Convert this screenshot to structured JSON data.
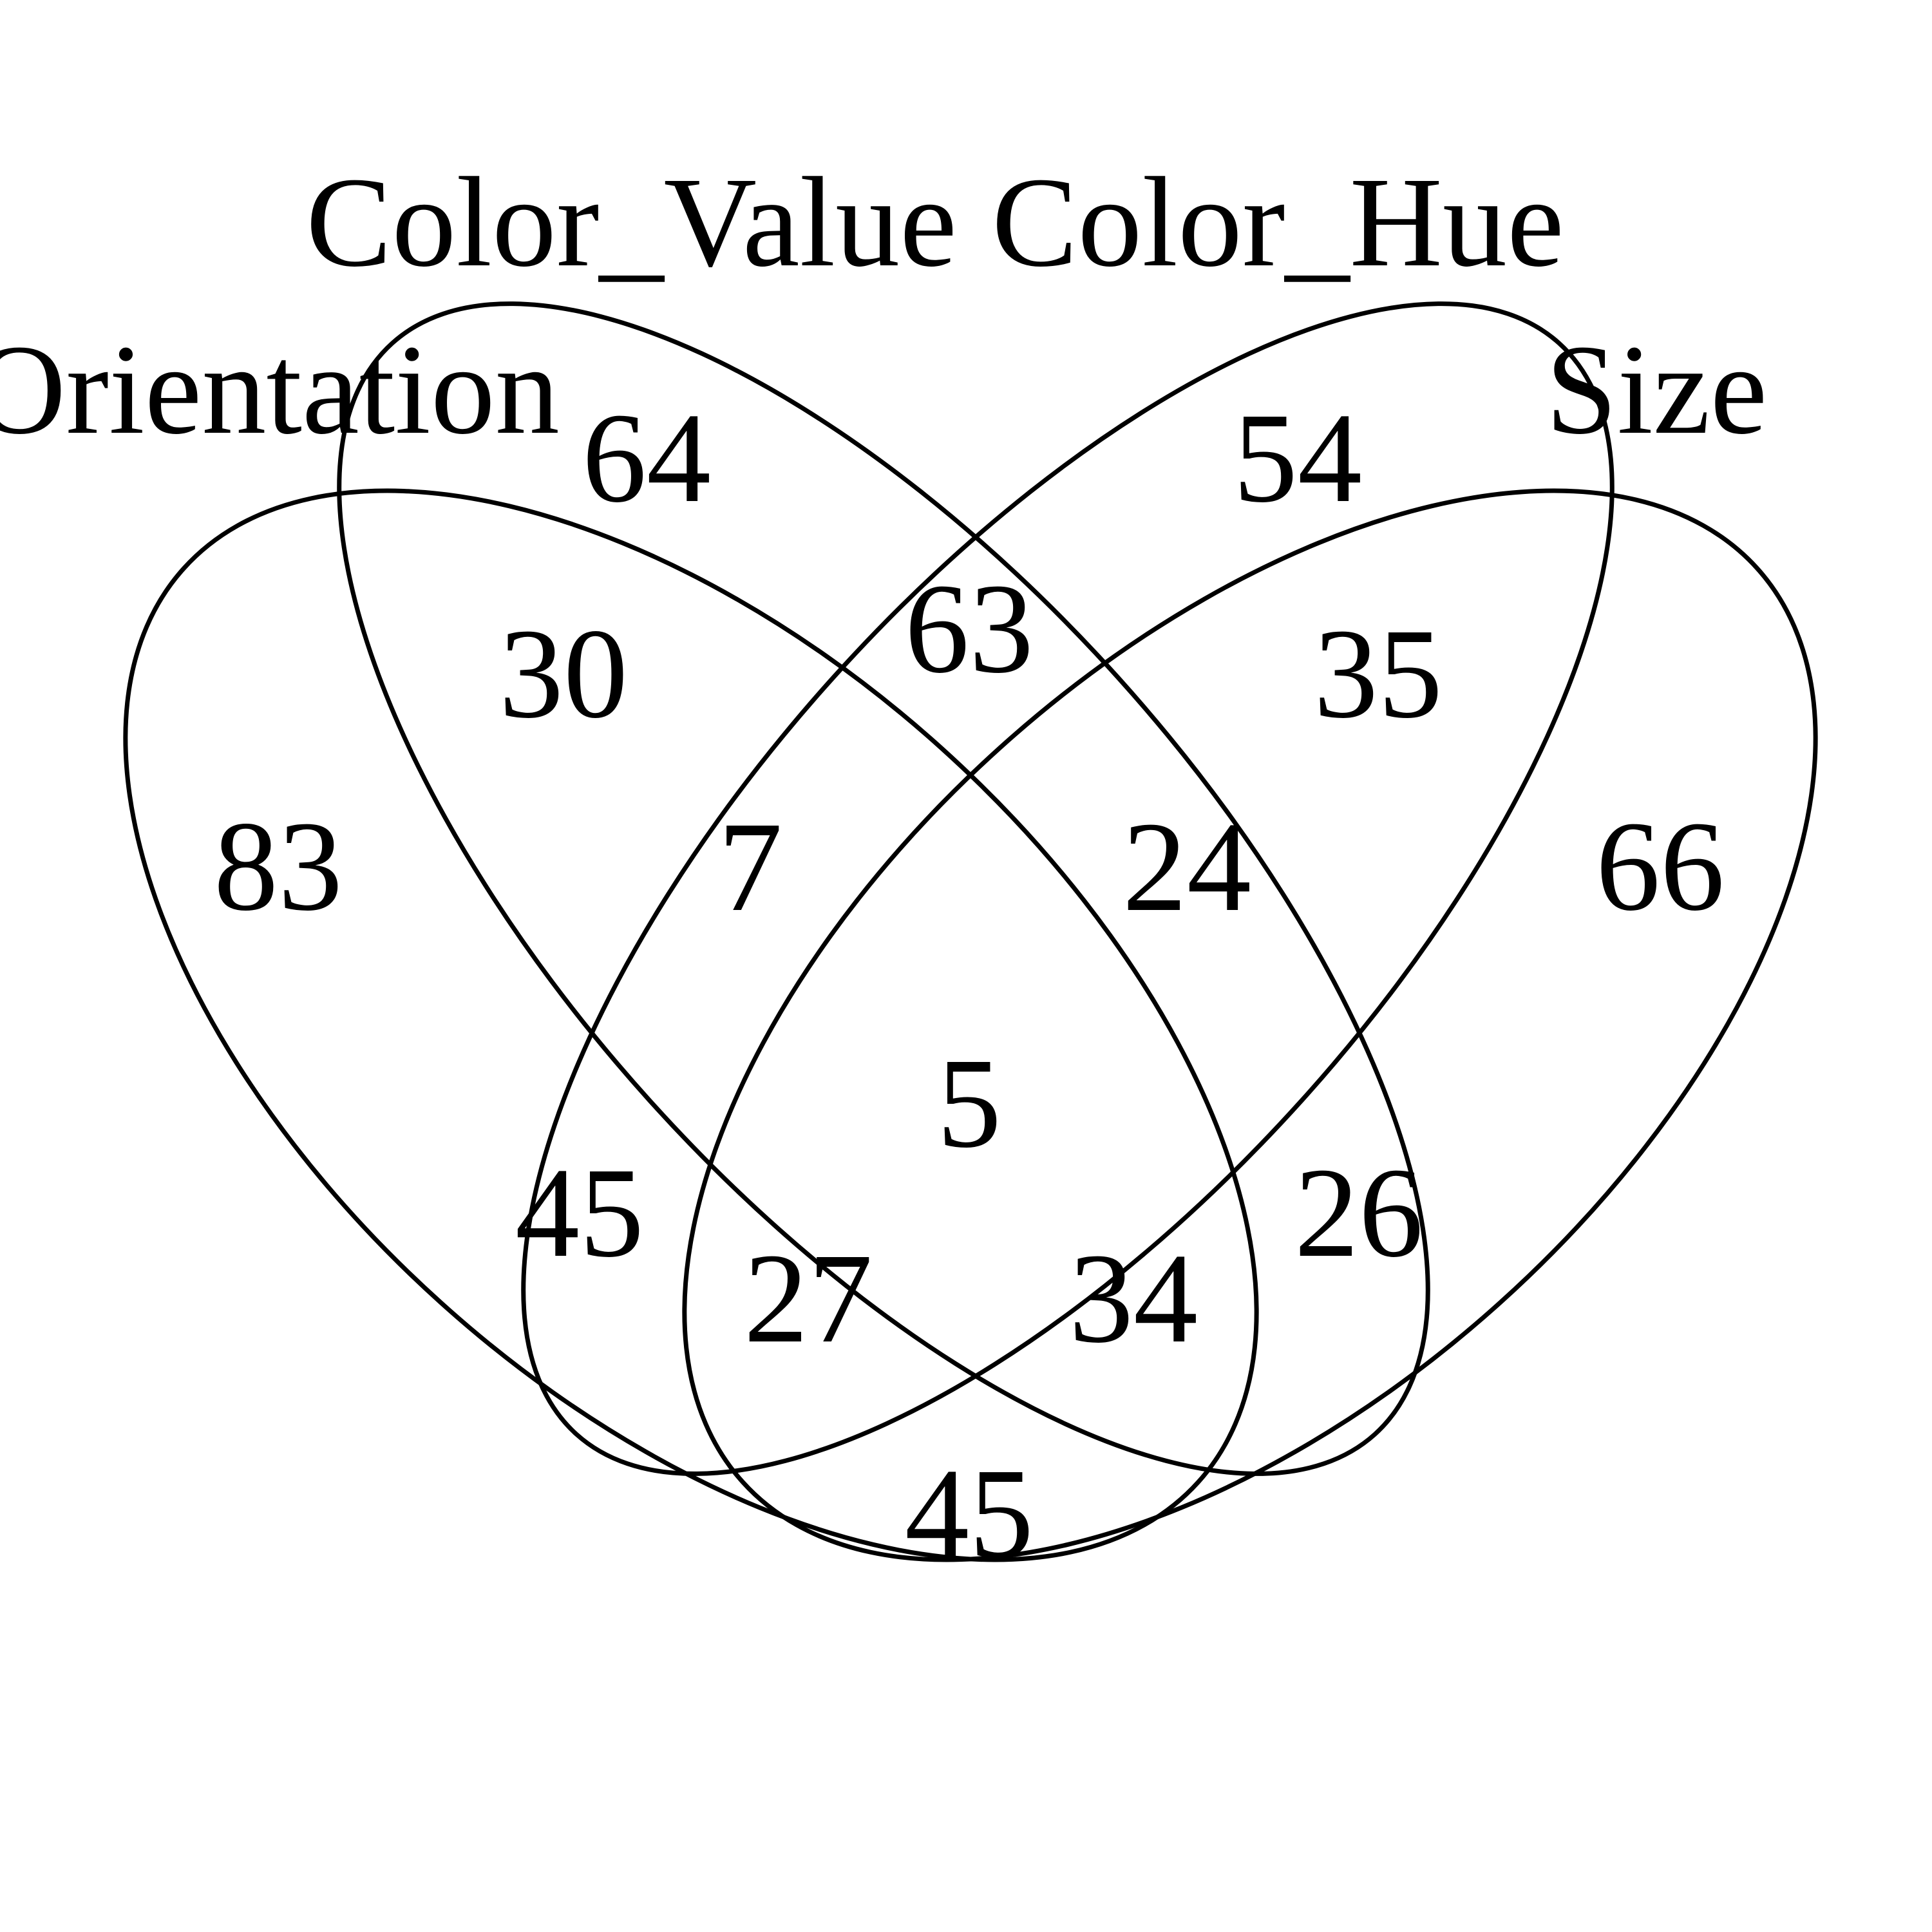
{
  "diagram": {
    "type": "venn-4",
    "sets": [
      {
        "id": "orientation",
        "label": "Orientation"
      },
      {
        "id": "color_value",
        "label": "Color_Value"
      },
      {
        "id": "color_hue",
        "label": "Color_Hue"
      },
      {
        "id": "size",
        "label": "Size"
      }
    ],
    "regions": {
      "orientation_only": "83",
      "color_value_only": "64",
      "color_hue_only": "54",
      "size_only": "66",
      "orientation_color_value": "30",
      "color_value_color_hue": "63",
      "color_hue_size": "35",
      "orientation_color_value_color_hue": "7",
      "color_value_color_hue_size": "24",
      "all_four": "5",
      "orientation_color_hue": "45",
      "color_value_size": "26",
      "orientation_color_hue_size": "27",
      "orientation_color_value_size": "34",
      "orientation_size": "45"
    },
    "stroke_color": "#000000",
    "background_color": "#ffffff"
  }
}
